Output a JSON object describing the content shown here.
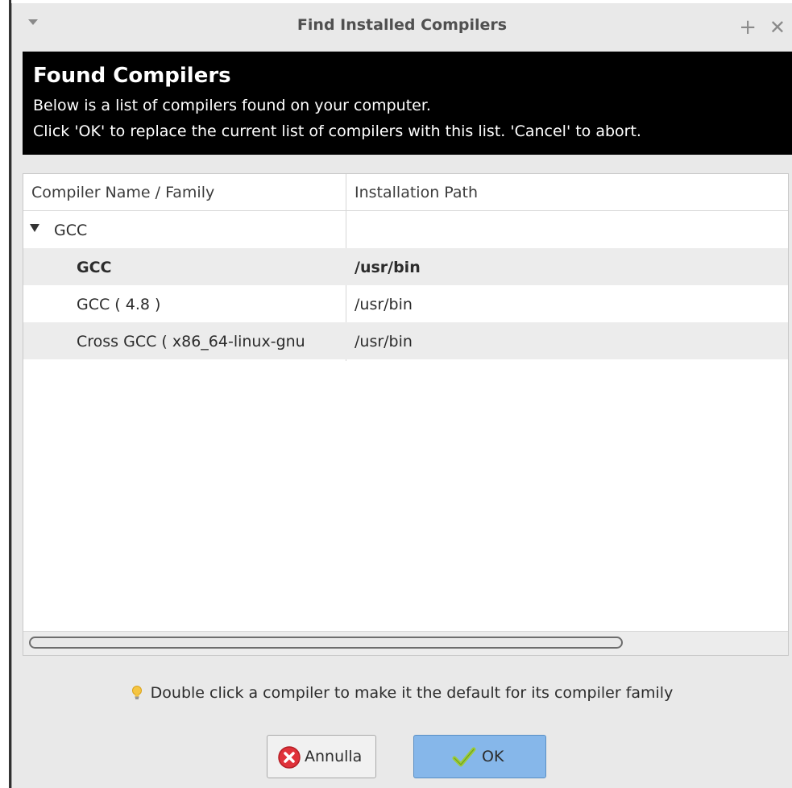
{
  "window": {
    "title": "Find Installed Compilers"
  },
  "header": {
    "title": "Found Compilers",
    "line1": "Below is a list of compilers found on your computer.",
    "line2": "Click 'OK' to replace the current list of compilers with this list. 'Cancel' to abort."
  },
  "table": {
    "columns": [
      "Compiler Name / Family",
      "Installation Path"
    ],
    "group": {
      "label": "GCC",
      "expanded": true
    },
    "rows": [
      {
        "name": "GCC",
        "path": "/usr/bin",
        "is_default": true
      },
      {
        "name": "GCC ( 4.8 )",
        "path": "/usr/bin",
        "is_default": false
      },
      {
        "name": "Cross GCC ( x86_64-linux-gnu",
        "path": "/usr/bin",
        "is_default": false
      }
    ]
  },
  "hint": {
    "icon": "lightbulb-icon",
    "text": "Double click a compiler to make it the default for its compiler family"
  },
  "buttons": {
    "cancel_label": "Annulla",
    "ok_label": "OK"
  },
  "colors": {
    "banner_bg": "#000000",
    "ok_button_bg": "#86b7ea",
    "cancel_icon": "#e0323a",
    "ok_check": "#9ccc3a"
  }
}
